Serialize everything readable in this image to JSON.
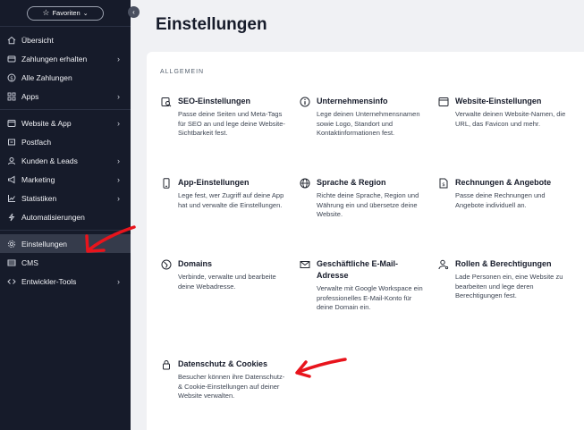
{
  "sidebar": {
    "favorites_label": "Favoriten",
    "items": [
      {
        "label": "Übersicht",
        "icon": "home-icon",
        "arrow": false
      },
      {
        "label": "Zahlungen erhalten",
        "icon": "payment-icon",
        "arrow": true
      },
      {
        "label": "Alle Zahlungen",
        "icon": "dollar-icon",
        "arrow": false
      },
      {
        "label": "Apps",
        "icon": "apps-icon",
        "arrow": true
      },
      {
        "label": "Website & App",
        "icon": "browser-icon",
        "arrow": true
      },
      {
        "label": "Postfach",
        "icon": "inbox-icon",
        "arrow": false
      },
      {
        "label": "Kunden & Leads",
        "icon": "contacts-icon",
        "arrow": true
      },
      {
        "label": "Marketing",
        "icon": "megaphone-icon",
        "arrow": true
      },
      {
        "label": "Statistiken",
        "icon": "chart-icon",
        "arrow": true
      },
      {
        "label": "Automatisierungen",
        "icon": "automation-icon",
        "arrow": false
      },
      {
        "label": "Einstellungen",
        "icon": "gear-icon",
        "arrow": false,
        "active": true
      },
      {
        "label": "CMS",
        "icon": "database-icon",
        "arrow": false
      },
      {
        "label": "Entwickler-Tools",
        "icon": "code-icon",
        "arrow": true
      }
    ]
  },
  "main": {
    "title": "Einstellungen",
    "section_label": "ALLGEMEIN",
    "tiles": [
      {
        "title": "SEO-Einstellungen",
        "desc": "Passe deine Seiten und Meta-Tags für SEO an und lege deine Website-Sichtbarkeit fest.",
        "icon": "seo-search-icon"
      },
      {
        "title": "Unternehmensinfo",
        "desc": "Lege deinen Unternehmensnamen sowie Logo, Standort und Kontaktinformationen fest.",
        "icon": "info-icon"
      },
      {
        "title": "Website-Einstellungen",
        "desc": "Verwalte deinen Website-Namen, die URL, das Favicon und mehr.",
        "icon": "window-icon"
      },
      {
        "title": "App-Einstellungen",
        "desc": "Lege fest, wer Zugriff auf deine App hat und verwalte die Einstellungen.",
        "icon": "mobile-icon"
      },
      {
        "title": "Sprache & Region",
        "desc": "Richte deine Sprache, Region und Währung ein und übersetze deine Website.",
        "icon": "globe-icon"
      },
      {
        "title": "Rechnungen & Angebote",
        "desc": "Passe deine Rechnungen und Angebote individuell an.",
        "icon": "document-dollar-icon"
      },
      {
        "title": "Domains",
        "desc": "Verbinde, verwalte und bearbeite deine Webadresse.",
        "icon": "domain-icon"
      },
      {
        "title": "Geschäftliche E-Mail-Adresse",
        "desc": "Verwalte mit Google Workspace ein professionelles E-Mail-Konto für deine Domain ein.",
        "icon": "mail-icon"
      },
      {
        "title": "Rollen & Berechtigungen",
        "desc": "Lade Personen ein, eine Website zu bearbeiten und lege deren Berechtigungen fest.",
        "icon": "person-key-icon"
      },
      {
        "title": "Datenschutz & Cookies",
        "desc": "Besucher können ihre Datenschutz- & Cookie-Einstellungen auf deiner Website verwalten.",
        "icon": "lock-icon"
      }
    ]
  },
  "colors": {
    "sidebar_bg": "#161b2a",
    "active_bg": "#353b4b",
    "page_bg": "#f0f1f4",
    "card_bg": "#ffffff",
    "annotation_arrow": "#e8141c"
  }
}
